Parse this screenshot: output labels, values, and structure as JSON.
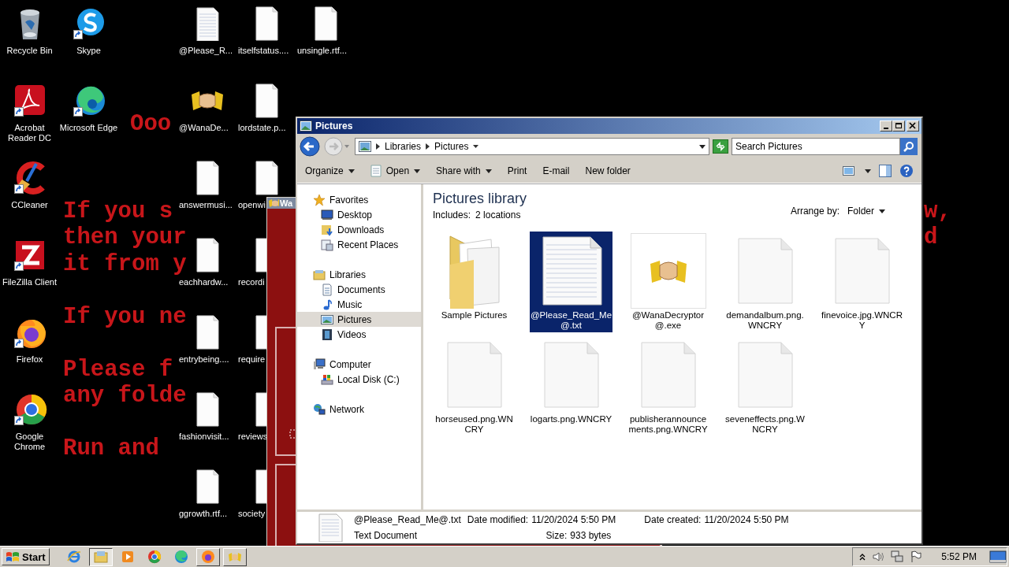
{
  "desktop": {
    "wallpaper": {
      "heading": "Ooo",
      "paragraphs": [
        [
          {
            "text": "If you s",
            "right": "w,"
          },
          {
            "text": "then your",
            "right": "d"
          },
          {
            "text": "it from y"
          }
        ],
        [
          {
            "text": "If you ne"
          }
        ],
        [
          {
            "text": "Please f"
          },
          {
            "text": "any folde"
          }
        ],
        [
          {
            "text": "Run and"
          }
        ]
      ]
    },
    "icon_rows": [
      [
        {
          "kind": "recycle-bin",
          "label": "Recycle Bin",
          "shortcut": false
        },
        {
          "kind": "skype",
          "label": "Skype",
          "shortcut": true
        },
        null,
        {
          "kind": "text-file",
          "label": "@Please_R...",
          "shortcut": false
        },
        {
          "kind": "blank-file",
          "label": "itselfstatus....",
          "shortcut": false
        },
        {
          "kind": "blank-file",
          "label": "unsingle.rtf...",
          "shortcut": false
        }
      ],
      [
        {
          "kind": "acrobat",
          "label": "Acrobat Reader DC",
          "shortcut": true
        },
        {
          "kind": "edge",
          "label": "Microsoft Edge",
          "shortcut": true
        },
        null,
        {
          "kind": "handshake",
          "label": "@WanaDe...",
          "shortcut": false
        },
        {
          "kind": "blank-file",
          "label": "lordstate.p...",
          "shortcut": false
        }
      ],
      [
        {
          "kind": "ccleaner",
          "label": "CCleaner",
          "shortcut": true
        },
        null,
        null,
        {
          "kind": "blank-file",
          "label": "answermusi...",
          "shortcut": false
        },
        {
          "kind": "blank-file",
          "label": "openwi",
          "shortcut": false
        }
      ],
      [
        {
          "kind": "filezilla",
          "label": "FileZilla Client",
          "shortcut": true
        },
        null,
        null,
        {
          "kind": "blank-file",
          "label": "eachhardw...",
          "shortcut": false
        },
        {
          "kind": "blank-file",
          "label": "recordi",
          "shortcut": false
        }
      ],
      [
        {
          "kind": "firefox",
          "label": "Firefox",
          "shortcut": true
        },
        null,
        null,
        {
          "kind": "blank-file",
          "label": "entrybeing....",
          "shortcut": false
        },
        {
          "kind": "blank-file",
          "label": "require",
          "shortcut": false
        }
      ],
      [
        {
          "kind": "chrome",
          "label": "Google Chrome",
          "shortcut": true
        },
        null,
        null,
        {
          "kind": "blank-file",
          "label": "fashionvisit...",
          "shortcut": false
        },
        {
          "kind": "blank-file",
          "label": "reviews",
          "shortcut": false
        }
      ],
      [
        null,
        null,
        null,
        {
          "kind": "blank-file",
          "label": "ggrowth.rtf...",
          "shortcut": false
        },
        {
          "kind": "blank-file",
          "label": "society",
          "shortcut": false
        }
      ]
    ]
  },
  "background_window": {
    "title": "Wa"
  },
  "window": {
    "title": "Pictures",
    "address": {
      "crumbs": [
        "Libraries",
        "Pictures"
      ]
    },
    "search": {
      "placeholder": "Search Pictures"
    },
    "toolbar": [
      {
        "label": "Organize",
        "kind": "dropdown"
      },
      {
        "label": "Open",
        "kind": "app-dropdown"
      },
      {
        "label": "Share with",
        "kind": "dropdown"
      },
      {
        "label": "Print",
        "kind": "plain"
      },
      {
        "label": "E-mail",
        "kind": "plain"
      },
      {
        "label": "New folder",
        "kind": "plain"
      }
    ],
    "sidebar": {
      "items": [
        {
          "label": "Favorites",
          "kind": "star",
          "selected": false,
          "children": [
            {
              "label": "Desktop",
              "kind": "desktop",
              "selected": false
            },
            {
              "label": "Downloads",
              "kind": "downloads",
              "selected": false
            },
            {
              "label": "Recent Places",
              "kind": "recent",
              "selected": false
            }
          ]
        },
        {
          "label": "Libraries",
          "kind": "library",
          "selected": false,
          "children": [
            {
              "label": "Documents",
              "kind": "documents",
              "selected": false
            },
            {
              "label": "Music",
              "kind": "music",
              "selected": false
            },
            {
              "label": "Pictures",
              "kind": "pictures",
              "selected": true
            },
            {
              "label": "Videos",
              "kind": "videos",
              "selected": false
            }
          ]
        },
        {
          "label": "Computer",
          "kind": "computer",
          "selected": false,
          "children": [
            {
              "label": "Local Disk (C:)",
              "kind": "disk",
              "selected": false
            }
          ]
        },
        {
          "label": "Network",
          "kind": "network",
          "selected": false
        }
      ]
    },
    "library": {
      "title": "Pictures library",
      "includes_label": "Includes:",
      "includes_link": "2 locations",
      "arrange_label": "Arrange by:",
      "arrange_value": "Folder"
    },
    "files": [
      {
        "name": "Sample Pictures",
        "kind": "folder",
        "selected": false
      },
      {
        "name": "@Please_Read_Me@.txt",
        "kind": "text",
        "selected": true
      },
      {
        "name": "@WanaDecryptor@.exe",
        "kind": "exe",
        "selected": false
      },
      {
        "name": "demandalbum.png.WNCRY",
        "kind": "blank",
        "selected": false
      },
      {
        "name": "finevoice.jpg.WNCRY",
        "kind": "blank",
        "selected": false
      },
      {
        "name": "horseused.png.WNCRY",
        "kind": "blank",
        "selected": false
      },
      {
        "name": "logarts.png.WNCRY",
        "kind": "blank",
        "selected": false
      },
      {
        "name": "publisherannouncements.png.WNCRY",
        "kind": "blank",
        "selected": false
      },
      {
        "name": "seveneffects.png.WNCRY",
        "kind": "blank",
        "selected": false
      }
    ],
    "details": {
      "name": "@Please_Read_Me@.txt",
      "type": "Text Document",
      "fields": [
        {
          "label": "Date modified:",
          "value": "11/20/2024 5:50 PM"
        },
        {
          "label": "Size:",
          "value": "933 bytes"
        },
        {
          "label": "Date created:",
          "value": "11/20/2024 5:50 PM"
        }
      ]
    }
  },
  "taskbar": {
    "start": "Start",
    "items": [
      {
        "kind": "ie",
        "open": false,
        "selected": false
      },
      {
        "kind": "explorer",
        "open": true,
        "selected": true
      },
      {
        "kind": "media",
        "open": false,
        "selected": false
      },
      {
        "kind": "chrome",
        "open": false,
        "selected": false
      },
      {
        "kind": "edge",
        "open": false,
        "selected": false
      },
      {
        "kind": "firefox",
        "open": true,
        "selected": false
      },
      {
        "kind": "handshake",
        "open": true,
        "selected": false
      }
    ],
    "clock": "5:52 PM"
  }
}
